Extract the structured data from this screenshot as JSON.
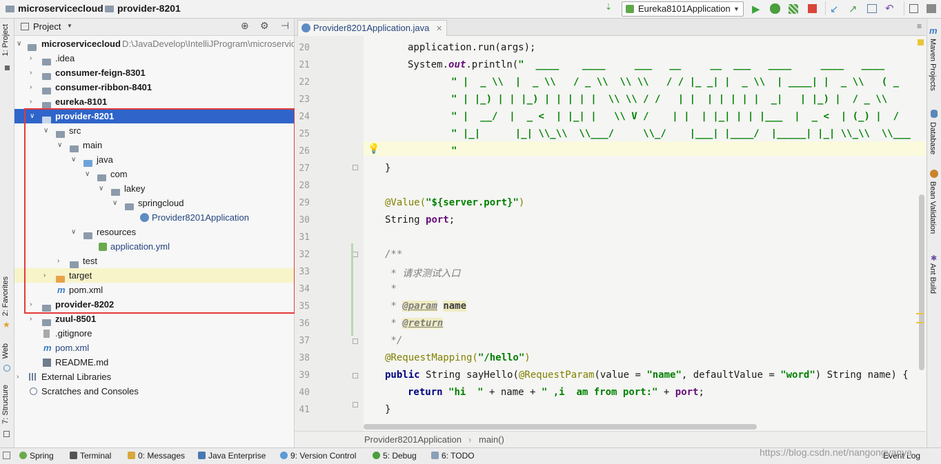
{
  "navbar": {
    "crumbs": [
      "microservicecloud",
      "provider-8201"
    ],
    "run_config": "Eureka8101Application"
  },
  "left_strip": {
    "tabs": [
      "1: Project",
      "2: Favorites",
      "Web",
      "7: Structure"
    ]
  },
  "project_panel": {
    "title": "Project",
    "root_name": "microservicecloud",
    "root_path": "D:\\JavaDevelop\\IntelliJProgram\\microservic",
    "items": [
      {
        "label": "microservicecloud"
      },
      {
        "label": ".idea"
      },
      {
        "label": "consumer-feign-8301"
      },
      {
        "label": "consumer-ribbon-8401"
      },
      {
        "label": "eureka-8101"
      },
      {
        "label": "provider-8201"
      },
      {
        "label": "src"
      },
      {
        "label": "main"
      },
      {
        "label": "java"
      },
      {
        "label": "com"
      },
      {
        "label": "lakey"
      },
      {
        "label": "springcloud"
      },
      {
        "label": "Provider8201Application"
      },
      {
        "label": "resources"
      },
      {
        "label": "application.yml"
      },
      {
        "label": "test"
      },
      {
        "label": "target"
      },
      {
        "label": "pom.xml"
      },
      {
        "label": "provider-8202"
      },
      {
        "label": "zuul-8501"
      },
      {
        "label": ".gitignore"
      },
      {
        "label": "pom.xml"
      },
      {
        "label": "README.md"
      },
      {
        "label": "External Libraries"
      },
      {
        "label": "Scratches and Consoles"
      }
    ]
  },
  "editor": {
    "tab_label": "Provider8201Application.java",
    "line_numbers": [
      "20",
      "21",
      "22",
      "23",
      "24",
      "25",
      "26",
      "27",
      "28",
      "29",
      "30",
      "31",
      "32",
      "33",
      "34",
      "35",
      "36",
      "37",
      "38",
      "39",
      "40",
      "41"
    ],
    "lines": {
      "l20": "application.run(args);",
      "l21_a": "System.",
      "l21_b": "out",
      "l21_c": ".println(",
      "l21_d": "\"  ____    ____     ___   __     __  ___   ____     ____   ____",
      "l22": "\" |  _ \\\\  |  _ \\\\   / _ \\\\  \\\\ \\\\   / / |_ _| |  _ \\\\  | ____| |  _ \\\\   ( _",
      "l23": "\" | |_) | | |_) | | | | |  \\\\ \\\\ / /   | |  | | | | |  _|   | |_) |  / _ \\\\",
      "l24": "\" |  __/  |  _ <  | |_| |   \\\\ V /    | |  | |_| | | |___  |  _ <  | (_) |  /",
      "l25": "\" |_|      |_| \\\\_\\\\  \\\\___/     \\\\_/    |___| |____/  |_____| |_| \\\\_\\\\  \\\\___",
      "l26": "\"",
      "l27": "}",
      "l29_a": "@Value(",
      "l29_b": "\"${server.port}\"",
      "l29_c": ")",
      "l30_a": "String ",
      "l30_b": "port",
      "l30_c": ";",
      "l32": "/**",
      "l33": " * 请求测试入口",
      "l34": " *",
      "l35_a": " * ",
      "l35_b": "@param",
      "l35_c": "name",
      "l36_a": " * ",
      "l36_b": "@return",
      "l37": " */",
      "l38_a": "@RequestMapping(",
      "l38_b": "\"/hello\"",
      "l38_c": ")",
      "l39_a": "public",
      "l39_b": " String sayHello(",
      "l39_c": "@RequestParam",
      "l39_d": "(value = ",
      "l39_e": "\"name\"",
      "l39_f": ", defaultValue = ",
      "l39_g": "\"word\"",
      "l39_h": ") String name) {",
      "l40_a": "return",
      "l40_b": "\"hi  \"",
      "l40_c": " + name + ",
      "l40_d": "\" ,i  am from port:\"",
      "l40_e": " + ",
      "l40_f": "port",
      "l40_g": ";",
      "l41": "}"
    },
    "breadcrumb": [
      "Provider8201Application",
      "main()"
    ]
  },
  "right_strip": {
    "tabs": [
      "Maven Projects",
      "Database",
      "Bean Validation",
      "Ant Build"
    ]
  },
  "bottom_bar": {
    "items": [
      "Spring",
      "Terminal",
      "0: Messages",
      "Java Enterprise",
      "9: Version Control",
      "5: Debug",
      "6: TODO",
      "Event Log"
    ],
    "watermark": "https://blog.csdn.net/nangongyanya"
  },
  "colors": {
    "selection": "#2f65ca",
    "highlight_box": "#e33a3a",
    "run_green": "#3aa63a",
    "stop_red": "#d9453b"
  }
}
